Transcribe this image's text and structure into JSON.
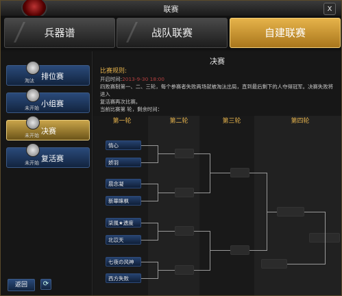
{
  "window": {
    "title": "联赛",
    "close_label": "x"
  },
  "tabs": [
    {
      "label": "兵器谱"
    },
    {
      "label": "战队联赛"
    },
    {
      "label": "自建联赛",
      "active": true
    }
  ],
  "sidebar": {
    "items": [
      {
        "label": "排位赛",
        "status": "淘汰"
      },
      {
        "label": "小组赛",
        "status": "未开始"
      },
      {
        "label": "决赛",
        "status": "未开始",
        "active": true
      },
      {
        "label": "复活赛",
        "status": "未开始"
      }
    ],
    "back_label": "返回",
    "refresh_icon": "refresh-icon"
  },
  "main": {
    "title": "决赛",
    "rules_heading": "比赛规则:",
    "open_time_label": "开启时间:",
    "open_time_value": "2013-9-30 18:00",
    "rules_line1": "四败赛制第一、二、三轮，每个参赛者失败两场就被淘汰出局，直到最后剩下的人夺得冠军。决赛失败将进入",
    "rules_line2": "复活赛再次比赛。",
    "current_line": "当前比赛第   轮，剩余时间："
  },
  "bracket": {
    "rounds": [
      "第一轮",
      "第二轮",
      "第三轮",
      "第四轮"
    ],
    "entrants": [
      "情心",
      "娇羽",
      "晨念凝",
      "新華睐枫",
      "柒風★遗度",
      "北苡天",
      "七夜の风神",
      "西方失败"
    ]
  },
  "colors": {
    "accent": "#e5b24c",
    "active_tab": "#d9a23c",
    "button_blue": "#2a4a7a"
  }
}
